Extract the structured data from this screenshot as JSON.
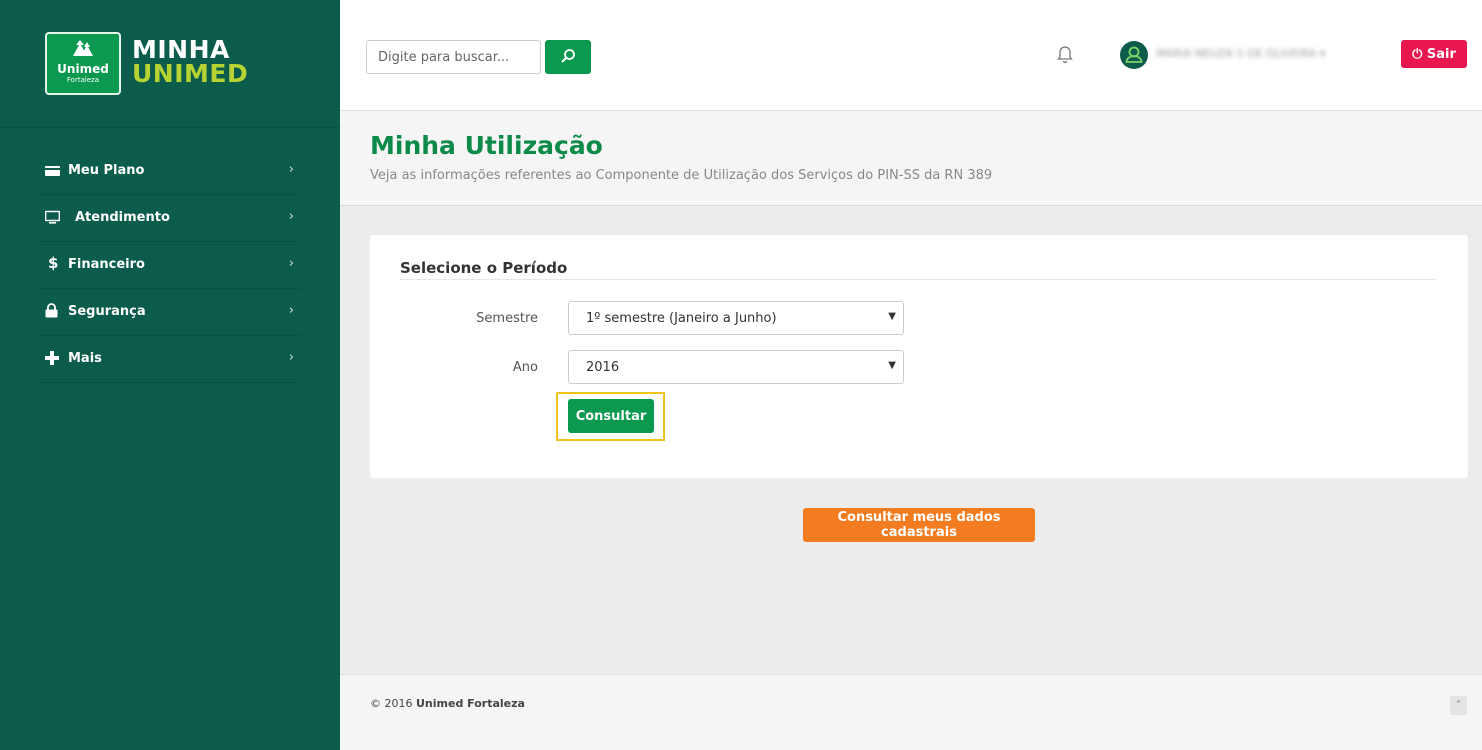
{
  "brand": {
    "logo_name": "Unimed",
    "logo_sub": "Fortaleza",
    "line1": "MINHA",
    "line2": "UNIMED"
  },
  "sidebar": {
    "items": [
      {
        "label": "Meu Plano",
        "icon": "card-icon"
      },
      {
        "label": "Atendimento",
        "icon": "monitor-icon"
      },
      {
        "label": "Financeiro",
        "icon": "dollar-icon"
      },
      {
        "label": "Segurança",
        "icon": "lock-icon"
      },
      {
        "label": "Mais",
        "icon": "plus-icon"
      }
    ]
  },
  "header": {
    "search_placeholder": "Digite para buscar...",
    "user_name": "MARIA NEUZA S DE OLIVEIRA",
    "logout_label": "Sair"
  },
  "page": {
    "title": "Minha Utilização",
    "subtitle": "Veja as informações referentes ao Componente de Utilização dos Serviços do PIN-SS da RN 389"
  },
  "form": {
    "section_title": "Selecione o Período",
    "semestre_label": "Semestre",
    "semestre_value": "1º semestre (Janeiro a Junho)",
    "ano_label": "Ano",
    "ano_value": "2016",
    "submit_label": "Consultar"
  },
  "secondary_action": {
    "label": "Consultar meus dados cadastrais"
  },
  "footer": {
    "copyright": "© 2016",
    "company": "Unimed Fortaleza"
  },
  "colors": {
    "sidebar": "#0b5c4b",
    "primary_green": "#0b9950",
    "title_green": "#0b8a48",
    "lime": "#b7d333",
    "logout_red": "#e8174f",
    "orange": "#f47c20",
    "highlight_yellow": "#f0c419"
  }
}
